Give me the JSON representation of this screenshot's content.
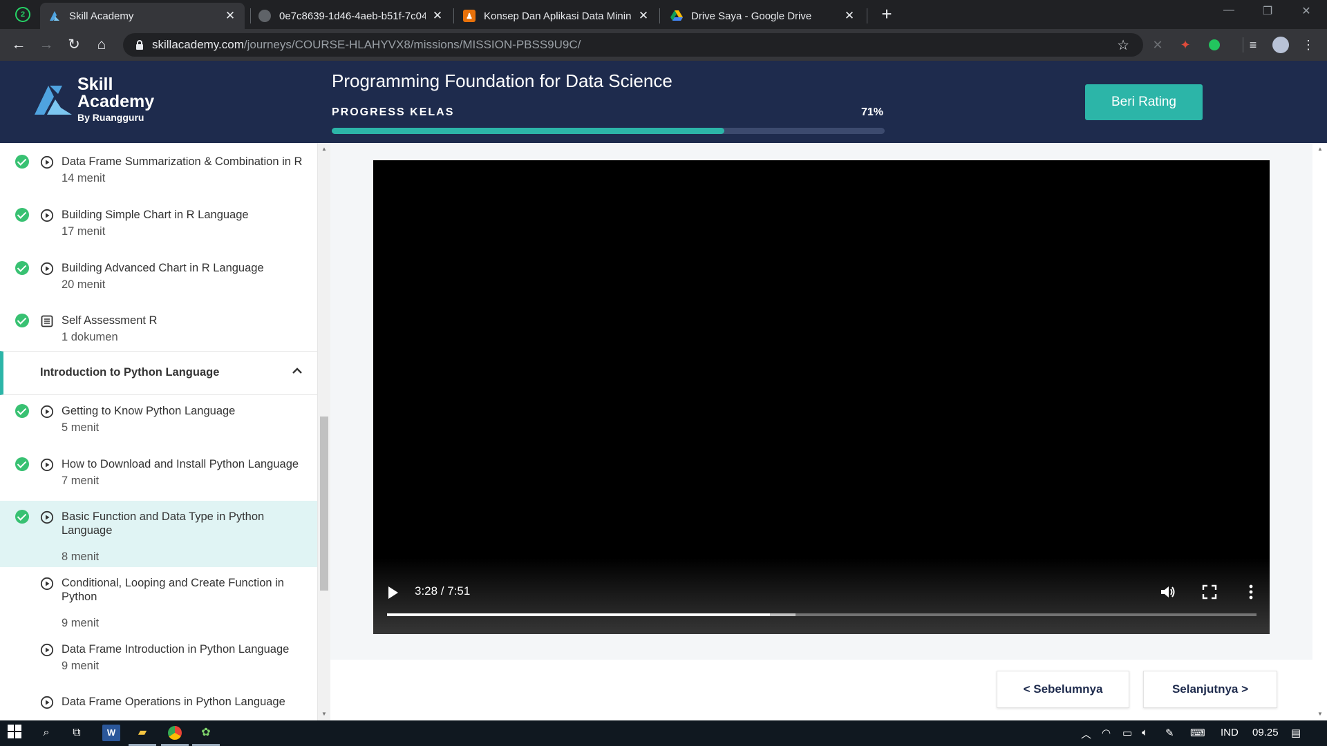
{
  "browser": {
    "tabs": [
      {
        "title": "Skill Academy",
        "active": true
      },
      {
        "title": "0e7c8639-1d46-4aeb-b51f-7c04",
        "active": false
      },
      {
        "title": "Konsep Dan Aplikasi Data Mining",
        "active": false
      },
      {
        "title": "Drive Saya - Google Drive",
        "active": false
      }
    ],
    "url_host": "skillacademy.com",
    "url_path": "/journeys/COURSE-HLAHYVX8/missions/MISSION-PBSS9U9C/"
  },
  "header": {
    "logo_line1": "Skill",
    "logo_line2": "Academy",
    "logo_sub": "By Ruangguru",
    "course_title": "Programming Foundation for Data Science",
    "progress_label": "PROGRESS KELAS",
    "progress_text": "71%",
    "progress_value": 0.71,
    "rating_button": "Beri Rating"
  },
  "sidebar": {
    "lessons_before": [
      {
        "title": "Data Frame Summarization & Combination in R",
        "meta": "14 menit",
        "type": "video",
        "done": true
      },
      {
        "title": "Building Simple Chart in R Language",
        "meta": "17 menit",
        "type": "video",
        "done": true
      },
      {
        "title": "Building Advanced Chart in R Language",
        "meta": "20 menit",
        "type": "video",
        "done": true
      },
      {
        "title": "Self Assessment R",
        "meta": "1 dokumen",
        "type": "document",
        "done": true
      }
    ],
    "section_title": "Introduction to Python Language",
    "lessons_after": [
      {
        "title": "Getting to Know Python Language",
        "meta": "5 menit",
        "type": "video",
        "done": true,
        "active": false
      },
      {
        "title": "How to Download and Install Python Language",
        "meta": "7 menit",
        "type": "video",
        "done": true,
        "active": false
      },
      {
        "title": "Basic Function and Data Type in Python Language",
        "meta": "8 menit",
        "type": "video",
        "done": true,
        "active": true
      },
      {
        "title": "Conditional, Looping and Create Function in Python",
        "meta": "9 menit",
        "type": "video",
        "done": false,
        "active": false
      },
      {
        "title": "Data Frame Introduction in Python Language",
        "meta": "9 menit",
        "type": "video",
        "done": false,
        "active": false
      },
      {
        "title": "Data Frame Operations in Python Language",
        "meta": "",
        "type": "video",
        "done": false,
        "active": false
      }
    ]
  },
  "video": {
    "time_display": "3:28 / 7:51",
    "played_fraction": 0.44,
    "buffered_fraction": 0.47
  },
  "footer": {
    "prev_label": "<  Sebelumnya",
    "next_label": "Selanjutnya  >"
  },
  "taskbar": {
    "language": "IND",
    "clock": "09.25"
  },
  "colors": {
    "header_bg": "#1e2b4d",
    "accent": "#2cb5a8",
    "done_green": "#38c172",
    "active_row": "#e0f4f4"
  }
}
